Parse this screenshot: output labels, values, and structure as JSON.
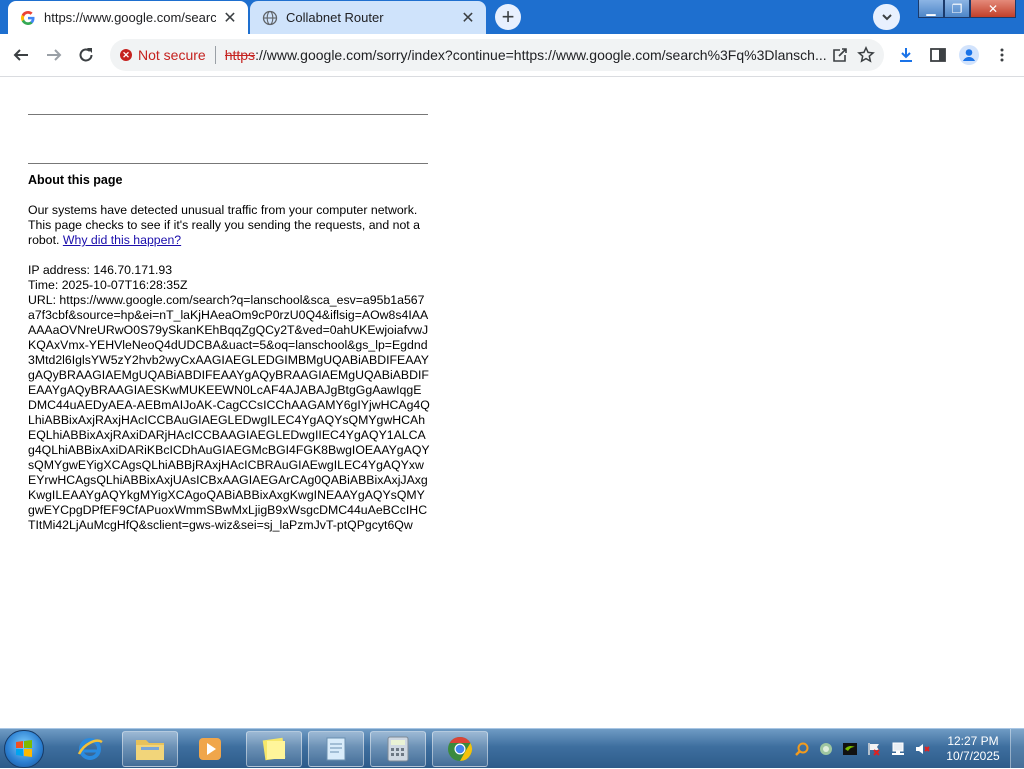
{
  "browser": {
    "tabs": [
      {
        "title": "https://www.google.com/search?q=lanschool",
        "favicon": "google-g",
        "active": true
      },
      {
        "title": "Collabnet Router",
        "favicon": "globe",
        "active": false
      }
    ],
    "address_bar": {
      "security_label": "Not secure",
      "url_scheme": "https",
      "url_rest": "://www.google.com/sorry/index?continue=https://www.google.com/search%3Fq%3Dlansch..."
    },
    "colors": {
      "tabstrip": "#1e6fcf",
      "not_secure": "#c5221f",
      "link": "#1a0dab"
    }
  },
  "page": {
    "heading": "About this page",
    "paragraph": "Our systems have detected unusual traffic from your computer network. This page checks to see if it's really you sending the requests, and not a robot.",
    "link_text": "Why did this happen?",
    "ip_line": "IP address: 146.70.171.93",
    "time_line": "Time: 2025-10-07T16:28:35Z",
    "url_line": "URL: https://www.google.com/search?q=lanschool&sca_esv=a95b1a567a7f3cbf&source=hp&ei=nT_laKjHAeaOm9cP0rzU0Q4&iflsig=AOw8s4IAAAAAaOVNreURwO0S79ySkanKEhBqqZgQCy2T&ved=0ahUKEwjoiafvwJKQAxVmx-YEHVleNeoQ4dUDCBA&uact=5&oq=lanschool&gs_lp=Egdnd3Mtd2l6IglsYW5zY2hvb2wyCxAAGIAEGLEDGIMBMgUQABiABDIFEAAYgAQyBRAAGIAEMgUQABiABDIFEAAYgAQyBRAAGIAEMgUQABiABDIFEAAYgAQyBRAAGIAESKwMUKEEWN0LcAF4AJABAJgBtgGgAawIqgEDMC44uAEDyAEA-AEBmAIJoAK-CagCCsICChAAGAMY6gIYjwHCAg4QLhiABBixAxjRAxjHAcICCBAuGIAEGLEDwgILEC4YgAQYsQMYgwHCAhEQLhiABBixAxjRAxiDARjHAcICCBAAGIAEGLEDwgIIEC4YgAQY1ALCAg4QLhiABBixAxiDARiKBcICDhAuGIAEGMcBGI4FGK8BwgIOEAAYgAQYsQMYgwEYigXCAgsQLhiABBjRAxjHAcICBRAuGIAEwgILEC4YgAQYxwEYrwHCAgsQLhiABBixAxjUAsICBxAAGIAEGArCAg0QABiABBixAxjJAxgKwgILEAAYgAQYkgMYigXCAgoQABiABBixAxgKwgINEAAYgAQYsQMYgwEYCpgDPfEF9CfAPuoxWmmSBwMxLjigB9xWsgcDMC44uAeBCcIHCTItMi42LjAuMcgHfQ&sclient=gws-wiz&sei=sj_laPzmJvT-ptQPgcyt6Qw"
  },
  "taskbar": {
    "clock_time": "12:27 PM",
    "clock_date": "10/7/2025",
    "apps": [
      "internet-explorer",
      "file-explorer",
      "media-player",
      "sticky-notes",
      "notepad",
      "calculator",
      "chrome"
    ],
    "tray_icons": [
      "search-tray-icon",
      "network-tray-icon",
      "nvidia-icon",
      "flag-icon",
      "network-icon",
      "volume-muted-icon"
    ]
  }
}
